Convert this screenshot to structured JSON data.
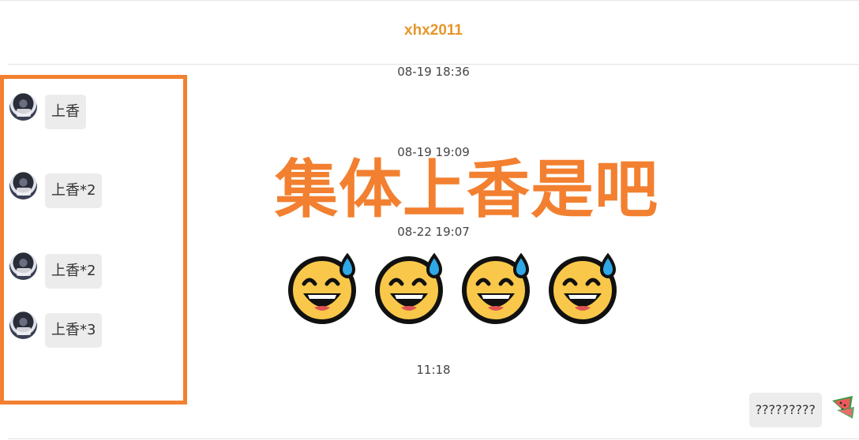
{
  "header": {
    "title": "xhx2011"
  },
  "timestamps": [
    "08-19 18:36",
    "08-19 19:09",
    "08-22 19:07",
    "11:18"
  ],
  "left_messages": [
    {
      "text": "上香"
    },
    {
      "text": "上香*2"
    },
    {
      "text": "上香*2"
    },
    {
      "text": "上香*3"
    }
  ],
  "overlay": {
    "caption": "集体上香是吧"
  },
  "emoji": {
    "name": "sweat-smile-emoji",
    "count": 4
  },
  "right_message": {
    "text": "?????????"
  },
  "colors": {
    "accent": "#e6962a",
    "highlight": "#f28030",
    "bubble": "#ececec"
  }
}
